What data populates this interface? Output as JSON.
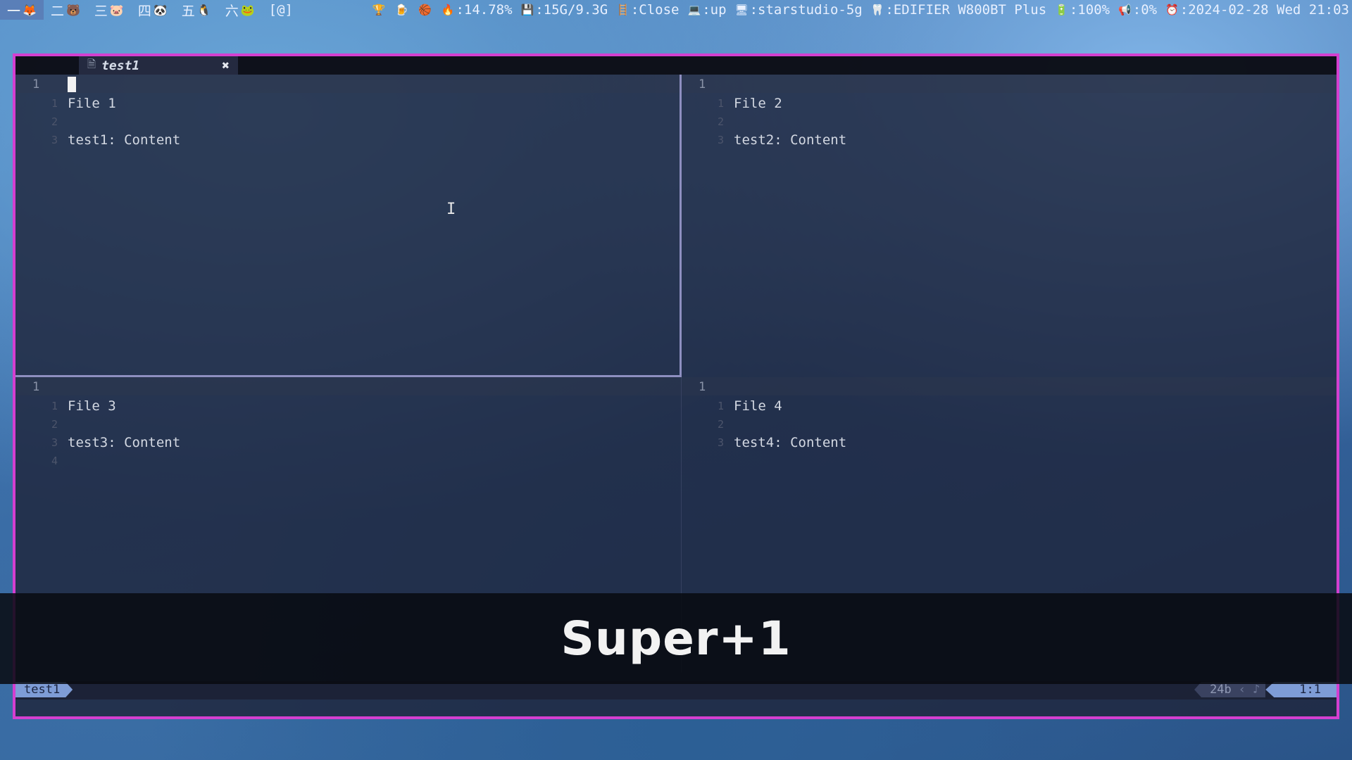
{
  "topbar": {
    "workspaces": [
      {
        "label": "一",
        "icon": "🦊",
        "active": true
      },
      {
        "label": "二",
        "icon": "🐻"
      },
      {
        "label": "三",
        "icon": "🐷"
      },
      {
        "label": "四",
        "icon": "🐼"
      },
      {
        "label": "五",
        "icon": "🐧"
      },
      {
        "label": "六",
        "icon": "🐸"
      },
      {
        "label": "[@]",
        "icon": ""
      }
    ],
    "status": {
      "trophy": "🏆",
      "cup": "🍺",
      "ball": "🏀",
      "cpu": ":14.78%",
      "mem": ":15G/9.3G",
      "vpn": ":Close",
      "net": ":up",
      "wifi": ":starstudio-5g",
      "bluetooth": ":EDIFIER W800BT Plus",
      "battery": ":100%",
      "volume": ":0%",
      "clock": ":2024-02-28 Wed 21:03"
    }
  },
  "editor": {
    "tab": {
      "title": "test1",
      "icon": "file-icon",
      "close": "✖"
    },
    "panes": [
      {
        "header_num": "1",
        "lines": [
          {
            "ln": "1",
            "text": "File 1"
          },
          {
            "ln": "2",
            "text": ""
          },
          {
            "ln": "3",
            "text": "test1: Content"
          }
        ]
      },
      {
        "header_num": "1",
        "lines": [
          {
            "ln": "1",
            "text": "File 2"
          },
          {
            "ln": "2",
            "text": ""
          },
          {
            "ln": "3",
            "text": "test2: Content"
          }
        ]
      },
      {
        "header_num": "1",
        "lines": [
          {
            "ln": "1",
            "text": "File 3"
          },
          {
            "ln": "2",
            "text": ""
          },
          {
            "ln": "3",
            "text": "test3: Content"
          },
          {
            "ln": "4",
            "text": ""
          }
        ]
      },
      {
        "header_num": "1",
        "lines": [
          {
            "ln": "1",
            "text": "File 4"
          },
          {
            "ln": "2",
            "text": ""
          },
          {
            "ln": "3",
            "text": "test4: Content"
          }
        ]
      }
    ],
    "statusline": {
      "file": "test1",
      "size": "24b",
      "position": "1:1"
    }
  },
  "overlay": {
    "key_combo": "Super+1"
  },
  "colors": {
    "window_border": "#d43fd0",
    "statusline_accent": "#7e9cd6",
    "split_border": "#8e8fc0"
  }
}
